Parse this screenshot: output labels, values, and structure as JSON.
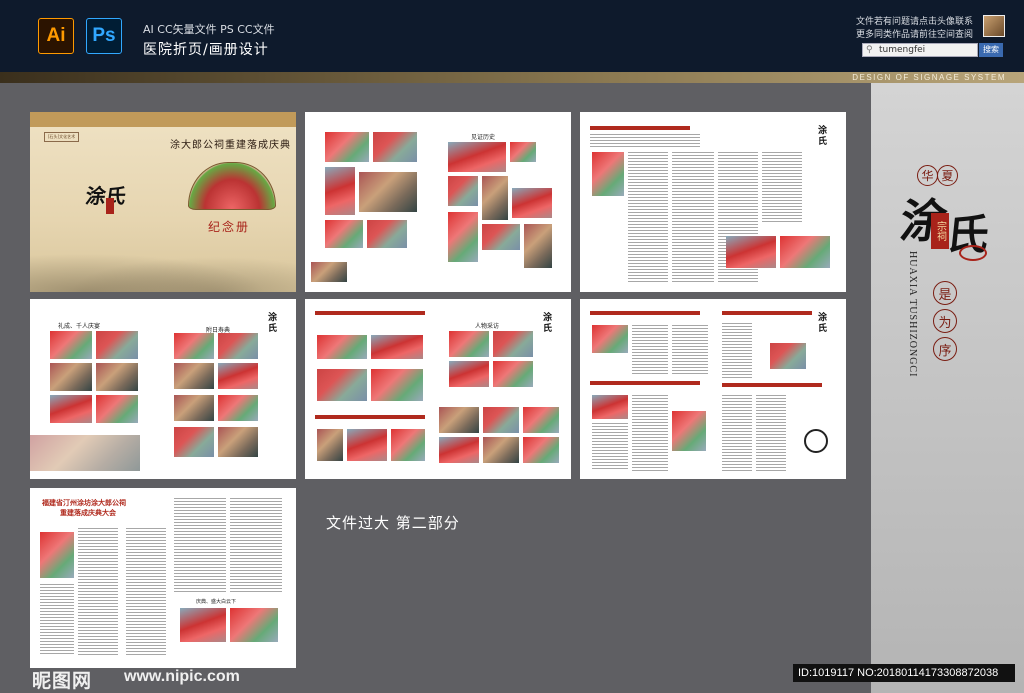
{
  "header": {
    "software_line": "AI CC矢量文件  PS CC文件",
    "category_line": "医院折页/画册设计",
    "ai_icon_label": "Ai",
    "ps_icon_label": "Ps",
    "notice_line1": "文件若有问题请点击头像联系",
    "notice_line2": "更多同类作品请前往空间查阅",
    "search_value": "tumengfei",
    "search_button": "搜索"
  },
  "band_text": "DESIGN OF SIGNAGE SYSTEM",
  "right_panel": {
    "hua": "华",
    "xia": "夏",
    "tu": "涂",
    "shi": "氏",
    "seal": "宗祠",
    "pinyin": "HUAXIA TUSHIZONGCI",
    "circles": [
      "是",
      "为",
      "序"
    ]
  },
  "cover": {
    "tag": "[石头]文化艺术",
    "title": "涂大郎公祠重建落成庆典",
    "memo": "纪念册",
    "brand": "涂氏"
  },
  "pages": {
    "p2_title": "见证历史",
    "p4_title": "礼成、千人庆宴",
    "p4b_title": "附日寿典",
    "p5_title": "人物采访",
    "p8_headline1": "福建省汀州涂坊涂大郎公祠",
    "p8_headline2": "重建落成庆典大会",
    "p8_subtitle": "庆典、盛大白云下"
  },
  "note": "文件过大  第二部分",
  "watermark": {
    "logo": "昵图网",
    "url": "www.nipic.com",
    "id": "ID:1019117 NO:20180114173308872038"
  },
  "colors": {
    "header_bg": "#0e1a2c",
    "canvas_bg": "#5f5f63",
    "accent_red": "#a8231a"
  }
}
